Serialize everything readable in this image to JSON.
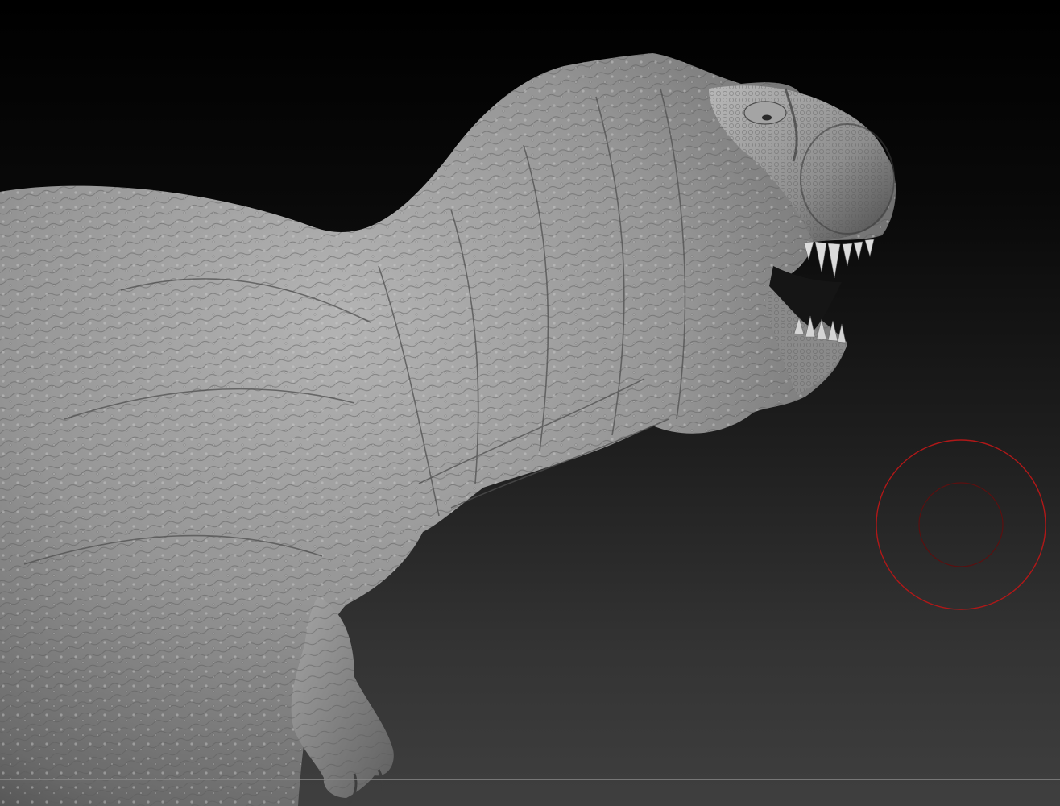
{
  "document": {
    "title": "",
    "subject_icon": "tyrannosaurus-sculpt"
  },
  "viewport": {
    "background_top_color": "#000000",
    "background_bottom_color": "#3f3f3f",
    "model_color": "#9a9a9a",
    "floor_line_color": "#8a8a8a"
  },
  "brush": {
    "outer_ring_color": "#b01818",
    "inner_ring_color": "#5a1010"
  }
}
